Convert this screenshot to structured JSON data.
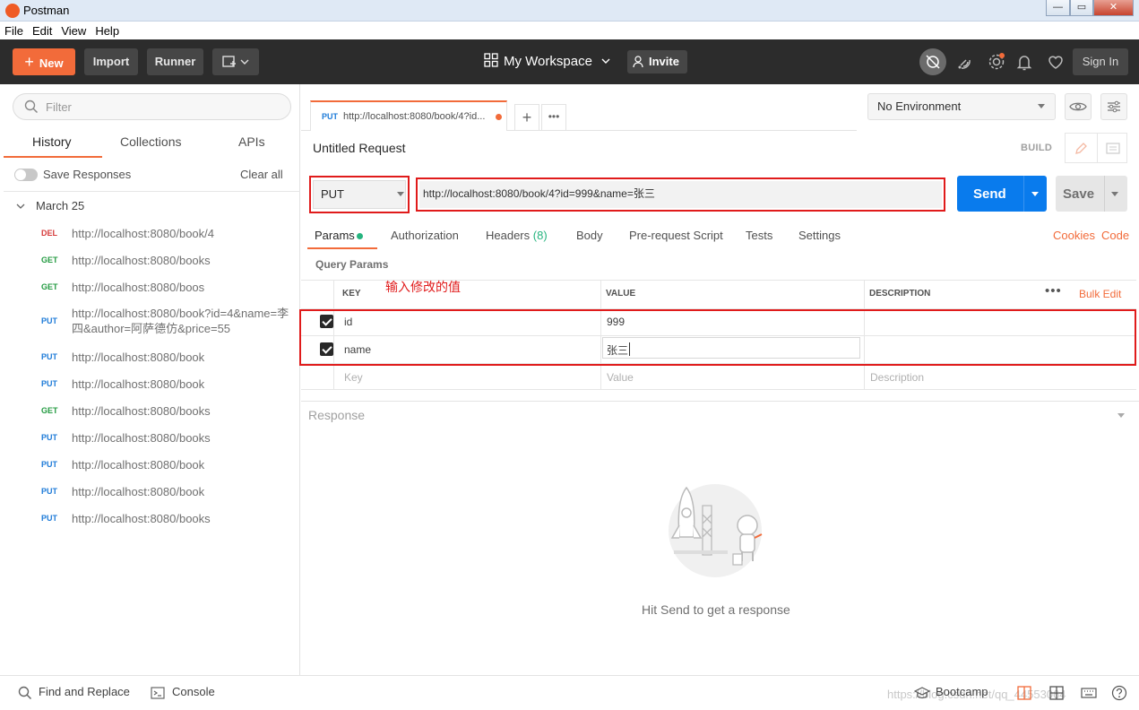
{
  "window": {
    "title": "Postman",
    "controls": [
      "—",
      "▭",
      "✕"
    ]
  },
  "menu": [
    "File",
    "Edit",
    "View",
    "Help"
  ],
  "header": {
    "new_label": "New",
    "import_label": "Import",
    "runner_label": "Runner",
    "workspace_label": "My Workspace",
    "invite_label": "Invite",
    "signin_label": "Sign In",
    "accent": "#f26b3a"
  },
  "sidebar": {
    "filter_placeholder": "Filter",
    "tabs": [
      "History",
      "Collections",
      "APIs"
    ],
    "save_responses": "Save Responses",
    "clear_all": "Clear all",
    "group": "March 25",
    "items": [
      {
        "method": "DEL",
        "url": "http://localhost:8080/book/4"
      },
      {
        "method": "GET",
        "url": "http://localhost:8080/books"
      },
      {
        "method": "GET",
        "url": "http://localhost:8080/boos"
      },
      {
        "method": "PUT",
        "url": "http://localhost:8080/book?id=4&name=李四&author=阿萨德仿&price=55"
      },
      {
        "method": "PUT",
        "url": "http://localhost:8080/book"
      },
      {
        "method": "PUT",
        "url": "http://localhost:8080/book"
      },
      {
        "method": "GET",
        "url": "http://localhost:8080/books"
      },
      {
        "method": "PUT",
        "url": "http://localhost:8080/books"
      },
      {
        "method": "PUT",
        "url": "http://localhost:8080/book"
      },
      {
        "method": "PUT",
        "url": "http://localhost:8080/book"
      },
      {
        "method": "PUT",
        "url": "http://localhost:8080/books"
      }
    ]
  },
  "tab": {
    "method": "PUT",
    "url": "http://localhost:8080/book/4?id..."
  },
  "environment": "No Environment",
  "request": {
    "title": "Untitled Request",
    "build": "BUILD",
    "method": "PUT",
    "url": "http://localhost:8080/book/4?id=999&name=张三",
    "send_label": "Send",
    "save_label": "Save",
    "tabs": {
      "params": "Params",
      "authorization": "Authorization",
      "headers": "Headers",
      "headers_count": "(8)",
      "body": "Body",
      "prerequest": "Pre-request Script",
      "tests": "Tests",
      "settings": "Settings"
    },
    "cookies": "Cookies",
    "code": "Code"
  },
  "query_params": {
    "title": "Query Params",
    "annotation": "输入修改的值",
    "headers": {
      "key": "KEY",
      "value": "VALUE",
      "description": "DESCRIPTION"
    },
    "bulk_edit": "Bulk Edit",
    "more": "•••",
    "rows": [
      {
        "key": "id",
        "value": "999",
        "description": ""
      },
      {
        "key": "name",
        "value": "张三",
        "description": ""
      }
    ],
    "placeholders": {
      "key": "Key",
      "value": "Value",
      "description": "Description"
    }
  },
  "response": {
    "title": "Response",
    "hint": "Hit Send to get a response"
  },
  "status": {
    "find_replace": "Find and Replace",
    "console": "Console",
    "bootcamp": "Bootcamp",
    "watermark": "https://blog.csdn.net/qq_44553064"
  }
}
